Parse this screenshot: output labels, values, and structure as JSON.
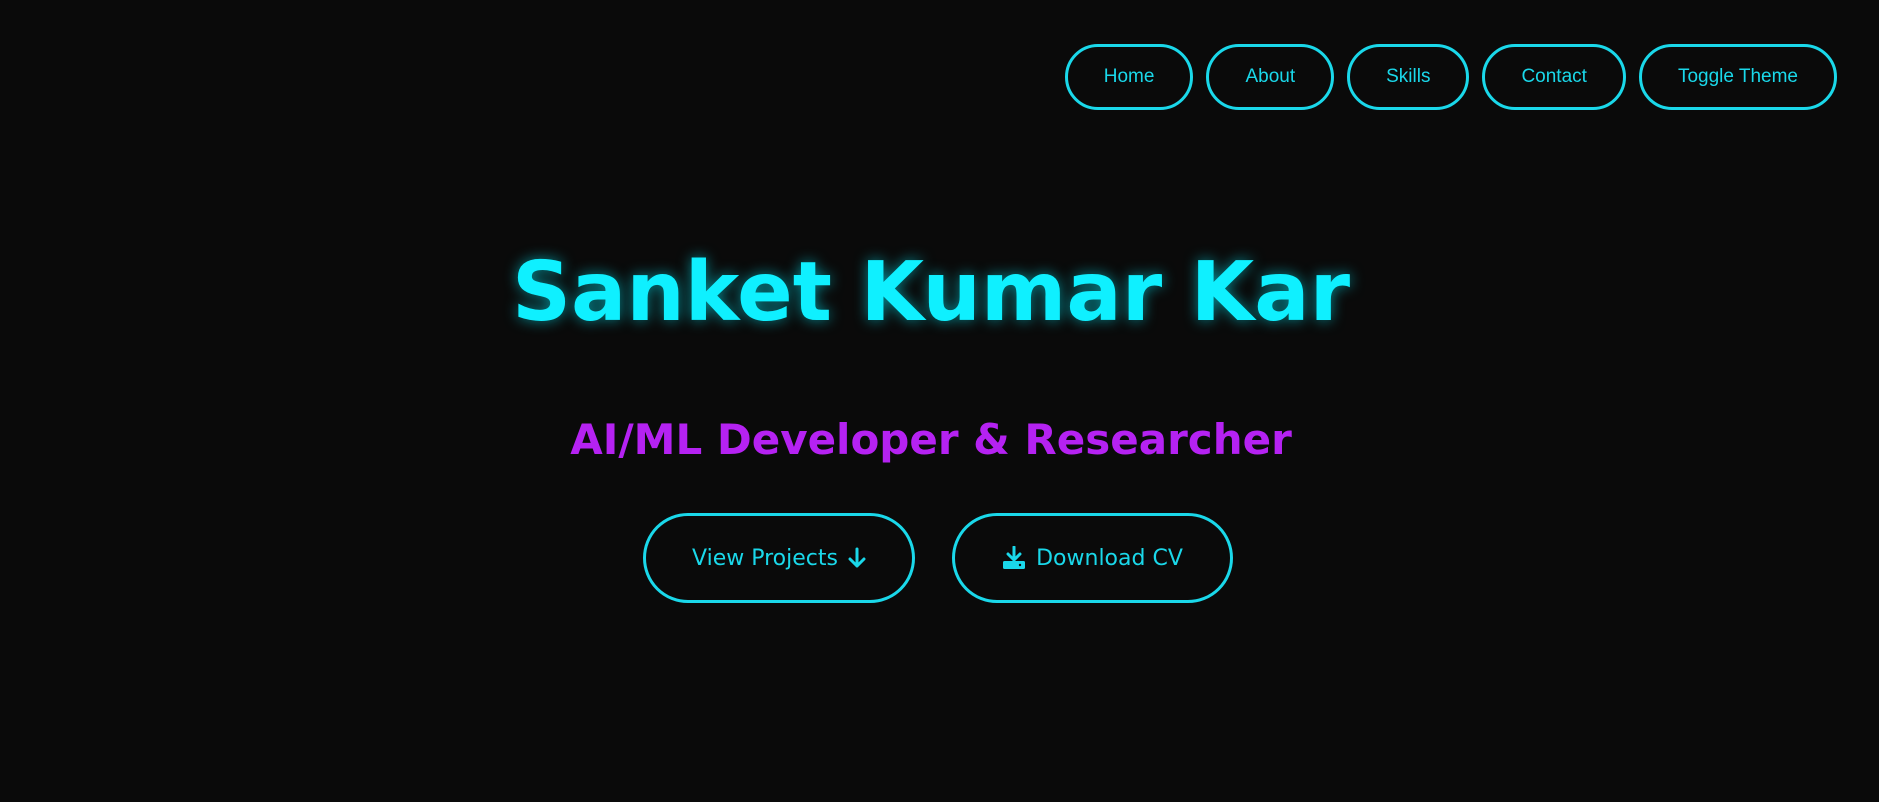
{
  "nav": {
    "items": [
      {
        "label": "Home"
      },
      {
        "label": "About"
      },
      {
        "label": "Skills"
      },
      {
        "label": "Contact"
      },
      {
        "label": "Toggle Theme"
      }
    ]
  },
  "hero": {
    "name": "Sanket Kumar Kar",
    "tagline": "AI/ML Developer & Researcher",
    "view_projects": {
      "label": "View Projects",
      "icon": "arrow-down-icon"
    },
    "download_cv": {
      "label": "Download CV",
      "icon": "download-icon"
    }
  },
  "colors": {
    "accent": "#1ad8ea",
    "title": "#0ff0ff",
    "secondary": "#b522f2",
    "background": "#0a0a0a"
  }
}
